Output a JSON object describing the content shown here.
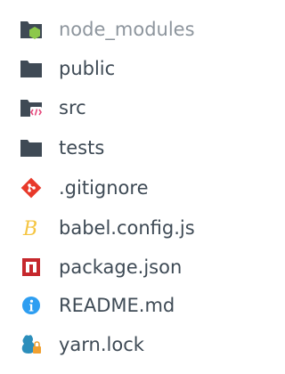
{
  "explorer": {
    "items": [
      {
        "label": "node_modules",
        "icon": "folder-node-icon",
        "dimmed": true
      },
      {
        "label": "public",
        "icon": "folder-icon"
      },
      {
        "label": "src",
        "icon": "folder-src-icon"
      },
      {
        "label": "tests",
        "icon": "folder-icon"
      },
      {
        "label": ".gitignore",
        "icon": "git-icon"
      },
      {
        "label": "babel.config.js",
        "icon": "babel-icon"
      },
      {
        "label": "package.json",
        "icon": "npm-icon"
      },
      {
        "label": "README.md",
        "icon": "info-icon"
      },
      {
        "label": "yarn.lock",
        "icon": "yarn-lock-icon"
      }
    ]
  },
  "colors": {
    "folder": "#3f4a55",
    "node_badge": "#8cc84b",
    "src_badge": "#e5477b",
    "git": "#e8392a",
    "babel": "#f5c542",
    "npm": "#c6282d",
    "info": "#2e9ef1",
    "yarn": "#2c8ebb",
    "lock": "#f0a030"
  }
}
